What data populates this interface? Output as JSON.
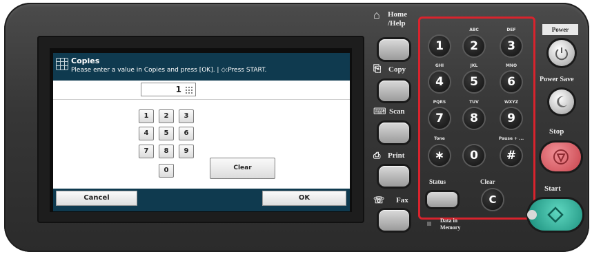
{
  "dialog": {
    "title": "Copies",
    "instruction": "Please enter a value in Copies and press [OK]. | ◇:Press START.",
    "value": "1",
    "keys": [
      "1",
      "2",
      "3",
      "4",
      "5",
      "6",
      "7",
      "8",
      "9",
      "0"
    ],
    "clear_label": "Clear",
    "cancel_label": "Cancel",
    "ok_label": "OK"
  },
  "side_buttons": {
    "home": [
      "Home",
      "/Help"
    ],
    "copy": "Copy",
    "scan": "Scan",
    "print": "Print",
    "fax": "Fax"
  },
  "keypad": {
    "keys": [
      {
        "digit": "1",
        "letters": ""
      },
      {
        "digit": "2",
        "letters": "ABC"
      },
      {
        "digit": "3",
        "letters": "DEF"
      },
      {
        "digit": "4",
        "letters": "GHI"
      },
      {
        "digit": "5",
        "letters": "JKL"
      },
      {
        "digit": "6",
        "letters": "MNO"
      },
      {
        "digit": "7",
        "letters": "PQRS"
      },
      {
        "digit": "8",
        "letters": "TUV"
      },
      {
        "digit": "9",
        "letters": "WXYZ"
      },
      {
        "digit": "∗",
        "letters": "Tone"
      },
      {
        "digit": "0",
        "letters": ""
      },
      {
        "digit": "#",
        "letters": "Pause + ..."
      }
    ],
    "highlight_color": "#d9232d"
  },
  "status_label": "Status",
  "clear_key": {
    "label": "Clear",
    "symbol": "C"
  },
  "data_in_memory": [
    "Data in",
    "Memory"
  ],
  "right_buttons": {
    "power": "Power",
    "power_save": "Power Save",
    "stop": "Stop",
    "start": "Start"
  },
  "colors": {
    "panel": "#363636",
    "lcd_bar": "#0f3a4f",
    "stop": "#d9565e",
    "start": "#1e9e8a"
  }
}
